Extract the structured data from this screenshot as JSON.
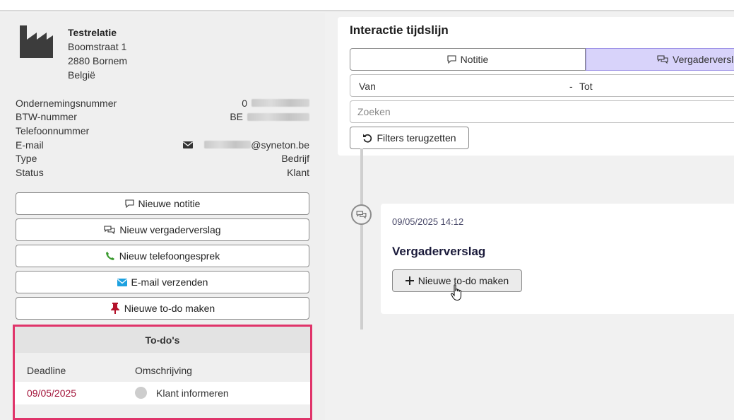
{
  "company": {
    "name": "Testrelatie",
    "street": "Boomstraat 1",
    "city": "2880 Bornem",
    "country": "België",
    "icon": "factory-icon"
  },
  "fields": [
    {
      "label": "Ondernemingsnummer",
      "value": "0",
      "redacted": true
    },
    {
      "label": "BTW-nummer",
      "value": "BE",
      "redacted": true
    },
    {
      "label": "Telefoonnummer",
      "value": ""
    },
    {
      "label": "E-mail",
      "value": "@syneton.be",
      "redacted": true,
      "icon": "envelope-icon"
    },
    {
      "label": "Type",
      "value": "Bedrijf"
    },
    {
      "label": "Status",
      "value": "Klant"
    }
  ],
  "actions": {
    "new_note": "Nieuwe notitie",
    "new_meeting": "Nieuw vergaderverslag",
    "new_call": "Nieuw telefoongesprek",
    "send_email": "E-mail verzenden",
    "new_todo": "Nieuwe to-do maken"
  },
  "todos": {
    "title": "To-do's",
    "columns": {
      "deadline": "Deadline",
      "description": "Omschrijving"
    },
    "rows": [
      {
        "deadline": "09/05/2025",
        "description": "Klant informeren"
      }
    ]
  },
  "timeline": {
    "title": "Interactie tijdslijn",
    "toggle": {
      "note": "Notitie",
      "meeting": "Vergaderverslag"
    },
    "range": {
      "from": "Van",
      "separator": "-",
      "to": "Tot"
    },
    "search_placeholder": "Zoeken",
    "reset_label": "Filters terugzetten",
    "entries": [
      {
        "date": "09/05/2025 14:12",
        "title": "Vergaderverslag",
        "button": "Nieuwe to-do maken"
      }
    ]
  },
  "colors": {
    "todo_border": "#e0346a",
    "deadline": "#a3153b",
    "active_toggle": "#d8d3fa",
    "phone": "#3a9a2e",
    "mail": "#1da1e0",
    "pin": "#b3112a"
  }
}
